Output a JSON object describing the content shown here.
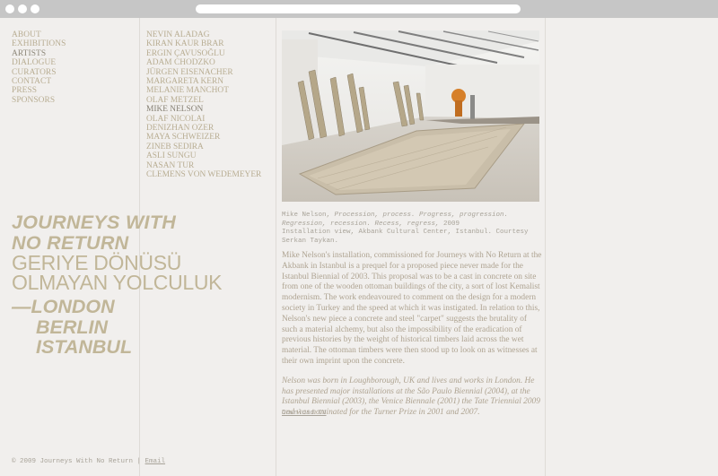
{
  "nav": {
    "items": [
      "ABOUT",
      "EXHIBITIONS",
      "ARTISTS",
      "DIALOGUE",
      "CURATORS",
      "CONTACT",
      "PRESS",
      "SPONSORS"
    ]
  },
  "artists": [
    "NEVIN ALADAG",
    "KIRAN KAUR BRAR",
    "ERGIN ÇAVUSOĞLU",
    "ADAM CHODZKO",
    "JÜRGEN EISENACHER",
    "MARGARETA KERN",
    "MELANIE MANCHOT",
    "OLAF METZEL",
    "MIKE NELSON",
    "OLAF NICOLAI",
    "DENIZHAN OZER",
    "MAYA SCHWEIZER",
    "ZINEB SEDIRA",
    "ASLI SUNGU",
    "NASAN TUR",
    "CLEMENS VON WEDEMEYER"
  ],
  "title": {
    "line1": "JOURNEYS WITH",
    "line2": "NO RETURN",
    "turkish1": "GERIYE DÖNÜSÜ",
    "turkish2": "OLMAYAN YOLCULUK",
    "city1": "—LONDON",
    "city2": "BERLIN",
    "city3": "ISTANBUL"
  },
  "caption": {
    "artist": "Mike Nelson,",
    "work_title": "Procession, process. Progress, progression. Regression, recession. Recess, regress,",
    "year": "2009",
    "details": "Installation view, Akbank Cultural Center, Istanbul. Courtesy Serkan Taykan."
  },
  "body": {
    "paragraph": "Mike Nelson's installation, commissioned for Journeys with No Return at the Akbank in Istanbul is a prequel for a proposed piece never made for the Istanbul Biennial of 2003. This proposal was to be a cast in concrete on site from one of the wooden ottoman buildings of the city, a sort of lost Kemalist modernism. The work endeavoured to comment on the design for a modern society in Turkey and the speed at which it was instigated. In relation to this, Nelson's new piece a concrete and steel \"carpet\" suggests the brutality of such a material alchemy, but also the impossibility of the eradication of previous histories by the weight of historical timbers laid across the wet material. The ottoman timbers were then stood up to look on as witnesses at their own imprint upon the concrete.",
    "bio": "Nelson was born in Loughborough, UK and lives and works in London. He has presented major installations at the São Paulo Biennial (2004), at the Istanbul Biennial (2003), the Venice Biennale (2001) the Tate Triennial 2009 and was nominated for the Turner Prize in 2001 and 2007."
  },
  "download_cv": "Download CV",
  "footer": {
    "copyright": "© 2009 Journeys With No Return |",
    "email": "Email"
  },
  "colors": {
    "accent": "#c1b698",
    "background": "#f1efed",
    "chrome": "#c6c6c6"
  }
}
